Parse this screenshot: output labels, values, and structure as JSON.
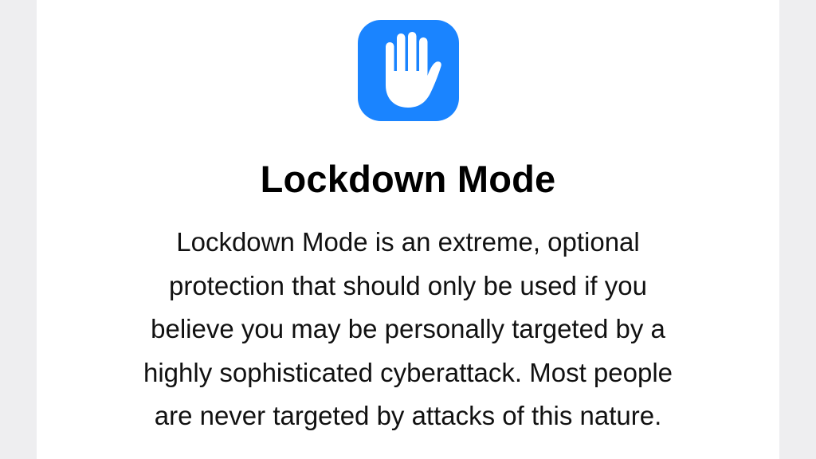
{
  "colors": {
    "accent": "#1a84ff",
    "background": "#eeeef0",
    "card": "#ffffff",
    "text": "#000000"
  },
  "header": {
    "icon": "raised-hand-icon",
    "title": "Lockdown Mode"
  },
  "description": {
    "lines": [
      "Lockdown Mode is an extreme, optional",
      "protection that should only be used if you",
      "believe you may be personally targeted by a",
      "highly sophisticated cyberattack. Most people",
      "are never targeted by attacks of this nature."
    ]
  }
}
